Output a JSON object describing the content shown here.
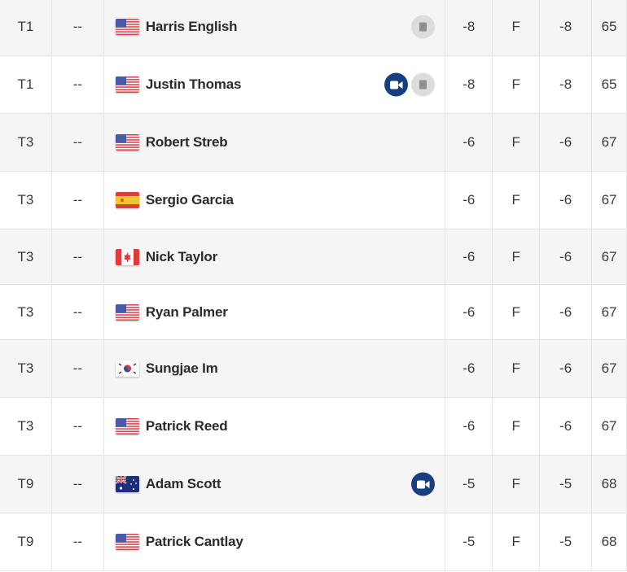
{
  "leaderboard": {
    "colors": {
      "video_icon_bg": "#173f80",
      "scorecard_icon_bg": "#dcdcdc",
      "row_alt_bg": "#f5f5f5"
    },
    "rows": [
      {
        "position": "T1",
        "movement": "--",
        "country": "USA",
        "player": "Harris English",
        "has_video": false,
        "has_scorecard": true,
        "to_par": "-8",
        "thru": "F",
        "round": "-8",
        "r1": "65"
      },
      {
        "position": "T1",
        "movement": "--",
        "country": "USA",
        "player": "Justin Thomas",
        "has_video": true,
        "has_scorecard": true,
        "to_par": "-8",
        "thru": "F",
        "round": "-8",
        "r1": "65"
      },
      {
        "position": "T3",
        "movement": "--",
        "country": "USA",
        "player": "Robert Streb",
        "has_video": false,
        "has_scorecard": false,
        "to_par": "-6",
        "thru": "F",
        "round": "-6",
        "r1": "67"
      },
      {
        "position": "T3",
        "movement": "--",
        "country": "ESP",
        "player": "Sergio Garcia",
        "has_video": false,
        "has_scorecard": false,
        "to_par": "-6",
        "thru": "F",
        "round": "-6",
        "r1": "67"
      },
      {
        "position": "T3",
        "movement": "--",
        "country": "CAN",
        "player": "Nick Taylor",
        "has_video": false,
        "has_scorecard": false,
        "to_par": "-6",
        "thru": "F",
        "round": "-6",
        "r1": "67"
      },
      {
        "position": "T3",
        "movement": "--",
        "country": "USA",
        "player": "Ryan Palmer",
        "has_video": false,
        "has_scorecard": false,
        "to_par": "-6",
        "thru": "F",
        "round": "-6",
        "r1": "67"
      },
      {
        "position": "T3",
        "movement": "--",
        "country": "KOR",
        "player": "Sungjae Im",
        "has_video": false,
        "has_scorecard": false,
        "to_par": "-6",
        "thru": "F",
        "round": "-6",
        "r1": "67"
      },
      {
        "position": "T3",
        "movement": "--",
        "country": "USA",
        "player": "Patrick Reed",
        "has_video": false,
        "has_scorecard": false,
        "to_par": "-6",
        "thru": "F",
        "round": "-6",
        "r1": "67"
      },
      {
        "position": "T9",
        "movement": "--",
        "country": "AUS",
        "player": "Adam Scott",
        "has_video": true,
        "has_scorecard": false,
        "to_par": "-5",
        "thru": "F",
        "round": "-5",
        "r1": "68"
      },
      {
        "position": "T9",
        "movement": "--",
        "country": "USA",
        "player": "Patrick Cantlay",
        "has_video": false,
        "has_scorecard": false,
        "to_par": "-5",
        "thru": "F",
        "round": "-5",
        "r1": "68"
      }
    ]
  }
}
